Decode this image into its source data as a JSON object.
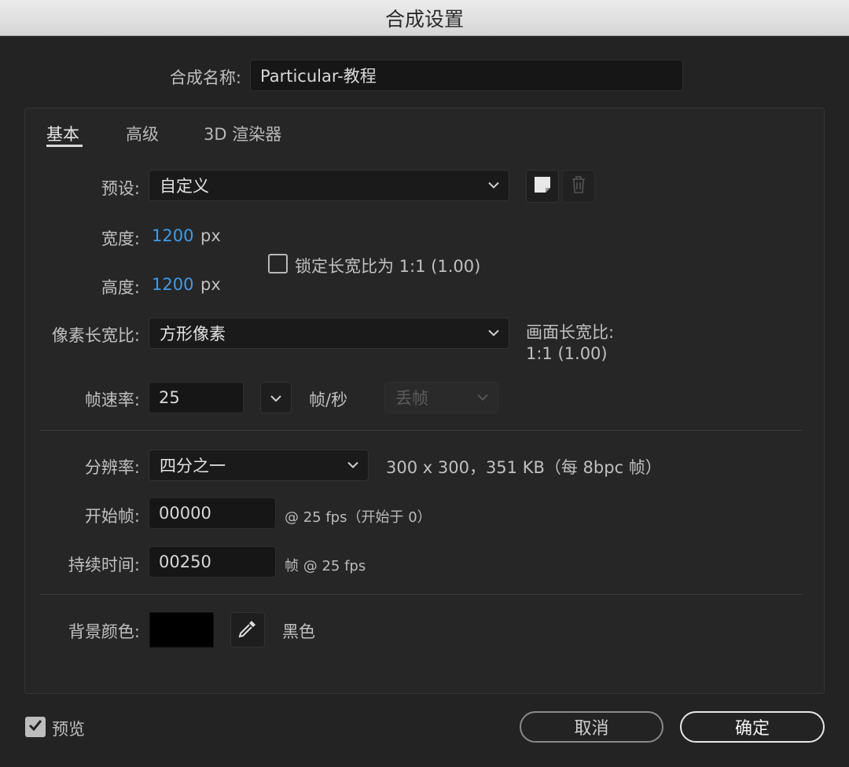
{
  "window": {
    "title": "合成设置"
  },
  "comp_name": {
    "label": "合成名称:",
    "value": "Particular-教程"
  },
  "tabs": [
    {
      "label": "基本",
      "active": true
    },
    {
      "label": "高级",
      "active": false
    },
    {
      "label": "3D 渲染器",
      "active": false
    }
  ],
  "preset": {
    "label": "预设:",
    "value": "自定义",
    "icons": [
      "new-preset-icon",
      "trash-icon"
    ]
  },
  "width": {
    "label": "宽度:",
    "value": "1200",
    "unit": "px"
  },
  "height": {
    "label": "高度:",
    "value": "1200",
    "unit": "px"
  },
  "lock_aspect": {
    "label": "锁定长宽比为 1:1 (1.00)",
    "checked": false
  },
  "pixel_aspect": {
    "label": "像素长宽比:",
    "value": "方形像素"
  },
  "frame_aspect": {
    "label": "画面长宽比:",
    "value": "1:1 (1.00)"
  },
  "frame_rate": {
    "label": "帧速率:",
    "value": "25",
    "unit": "帧/秒",
    "drop_frame": "丢帧"
  },
  "resolution": {
    "label": "分辨率:",
    "value": "四分之一",
    "info": "300 x 300，351 KB（每 8bpc 帧）"
  },
  "start_frame": {
    "label": "开始帧:",
    "value": "00000",
    "info": "@ 25 fps（开始于 0）"
  },
  "duration": {
    "label": "持续时间:",
    "value": "00250",
    "info": "帧 @ 25 fps"
  },
  "background": {
    "label": "背景颜色:",
    "color": "#000000",
    "name": "黑色"
  },
  "preview": {
    "label": "预览",
    "checked": true
  },
  "buttons": {
    "cancel": "取消",
    "ok": "确定"
  },
  "colors": {
    "accent_blue": "#3d9bea",
    "dialog_bg": "#232323"
  }
}
